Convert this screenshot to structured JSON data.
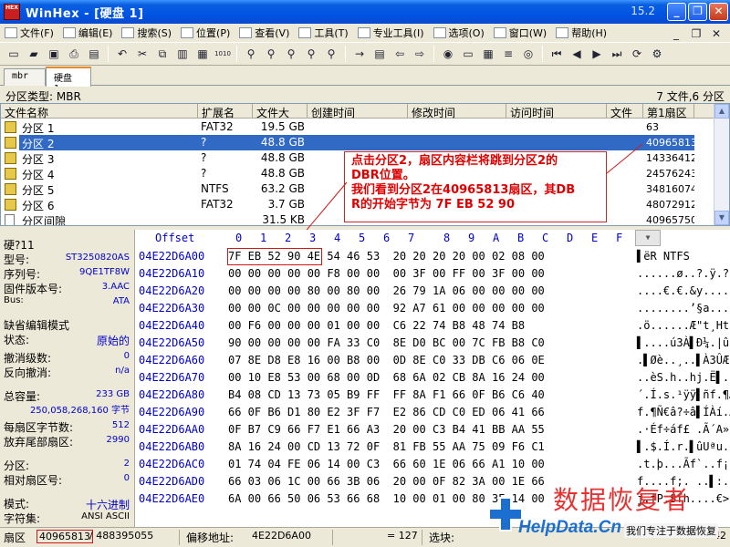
{
  "window": {
    "title": "WinHex - [硬盘 1]",
    "version": "15.2",
    "icon_label": "HEX"
  },
  "menu": [
    "文件(F)",
    "编辑(E)",
    "搜索(S)",
    "位置(P)",
    "查看(V)",
    "工具(T)",
    "专业工具(I)",
    "选项(O)",
    "窗口(W)",
    "帮助(H)"
  ],
  "tabs": [
    "mbr",
    "硬盘 1"
  ],
  "partition_info": {
    "label": "分区类型: MBR",
    "summary": "7 文件,6 分区"
  },
  "file_list": {
    "columns": [
      "文件名称",
      "扩展名",
      "文件大",
      "创建时间",
      "修改时间",
      "访问时间",
      "文件",
      "第1扇区"
    ],
    "rows": [
      {
        "name": "分区 1",
        "fs": "FAT32",
        "size": "19.5 GB",
        "sector": "63"
      },
      {
        "name": "分区 2",
        "fs": "?",
        "size": "48.8 GB",
        "sector": "40965813"
      },
      {
        "name": "分区 3",
        "fs": "?",
        "size": "48.8 GB",
        "sector": "143364123"
      },
      {
        "name": "分区 4",
        "fs": "?",
        "size": "48.8 GB",
        "sector": "245762433"
      },
      {
        "name": "分区 5",
        "fs": "NTFS",
        "size": "63.2 GB",
        "sector": "348160743"
      },
      {
        "name": "分区 6",
        "fs": "FAT32",
        "size": "3.7 GB",
        "sector": "480729123"
      },
      {
        "name": "分区间隙",
        "fs": "",
        "size": "31.5 KB",
        "sector": "40965750"
      }
    ]
  },
  "annotation": {
    "lines": [
      "点击分区2，扇区内容栏将跳到分区2的",
      "DBR位置。",
      "我们看到分区2在40965813扇区，其DB",
      "R的开始字节为 7F EB 52 90"
    ]
  },
  "info_panel": {
    "disk_label": "硬?11",
    "model_label": "型号:",
    "model": "ST3250820AS",
    "serial_label": "序列号:",
    "serial": "9QE1TF8W",
    "firmware_label": "固件版本号:",
    "firmware": "3.AAC",
    "bus_label": "Bus:",
    "bus": "ATA",
    "edit_mode_label": "缺省编辑模式",
    "state_label": "状态:",
    "state": "原始的",
    "undo_level_label": "撤消级数:",
    "undo_level": "0",
    "undo_reverse_label": "反向撤消:",
    "undo_reverse": "n/a",
    "capacity_label": "总容量:",
    "capacity": "233 GB",
    "capacity_bytes": "250,058,268,160 字节",
    "bytes_per_sector_label": "每扇区字节数:",
    "bytes_per_sector": "512",
    "surplus_sectors_label": "放弃尾部扇区:",
    "surplus_sectors": "2990",
    "partition_label": "分区:",
    "partition": "2",
    "relative_sector_label": "相对扇区号:",
    "relative_sector": "0",
    "mode_label": "模式:",
    "mode": "十六进制",
    "charset_label": "字符集:",
    "charset": "ANSI ASCII"
  },
  "hex_view": {
    "offset_header": "Offset",
    "columns": [
      "0",
      "1",
      "2",
      "3",
      "4",
      "5",
      "6",
      "7",
      "8",
      "9",
      "A",
      "B",
      "C",
      "D",
      "E",
      "F"
    ],
    "rows": [
      {
        "offset": "04E22D6A00",
        "bytes": "7F EB 52 90 4E 54 46 53  20 20 20 20 00 02 08 00",
        "ascii": "▌ëR NTFS"
      },
      {
        "offset": "04E22D6A10",
        "bytes": "00 00 00 00 00 F8 00 00  00 3F 00 FF 00 3F 00 00",
        "ascii": "......ø..?.ÿ.?.."
      },
      {
        "offset": "04E22D6A20",
        "bytes": "00 00 00 00 80 00 80 00  26 79 1A 06 00 00 00 00",
        "ascii": "....€.€.&y......"
      },
      {
        "offset": "04E22D6A30",
        "bytes": "00 00 0C 00 00 00 00 00  92 A7 61 00 00 00 00 00",
        "ascii": "........’§a....."
      },
      {
        "offset": "04E22D6A40",
        "bytes": "00 F6 00 00 00 01 00 00  C6 22 74 B8 48 74 B8",
        "ascii": ".ö......Æ\"t¸Ht¸"
      },
      {
        "offset": "04E22D6A50",
        "bytes": "90 00 00 00 00 FA 33 C0  8E D0 BC 00 7C FB B8 C0",
        "ascii": "▌....ú3À▌Ð¼.|û¸À"
      },
      {
        "offset": "04E22D6A60",
        "bytes": "07 8E D8 E8 16 00 B8 00  0D 8E C0 33 DB C6 06 0E",
        "ascii": ".▌Øè..¸..▌À3ÛÆ.."
      },
      {
        "offset": "04E22D6A70",
        "bytes": "00 10 E8 53 00 68 00 0D  68 6A 02 CB 8A 16 24 00",
        "ascii": "..èS.h..hj.Ë▌.$."
      },
      {
        "offset": "04E22D6A80",
        "bytes": "B4 08 CD 13 73 05 B9 FF  FF 8A F1 66 0F B6 C6 40",
        "ascii": "´.Í.s.¹ÿÿ▌ñf.¶Æ@"
      },
      {
        "offset": "04E22D6A90",
        "bytes": "66 0F B6 D1 80 E2 3F F7  E2 86 CD C0 ED 06 41 66",
        "ascii": "f.¶Ñ€â?÷â▌ÍÀí.Af"
      },
      {
        "offset": "04E22D6AA0",
        "bytes": "0F B7 C9 66 F7 E1 66 A3  20 00 C3 B4 41 BB AA 55",
        "ascii": ".·Éf÷áf£ .Ã´A»ªU"
      },
      {
        "offset": "04E22D6AB0",
        "bytes": "8A 16 24 00 CD 13 72 0F  81 FB 55 AA 75 09 F6 C1",
        "ascii": "▌.$.Í.r.▌ûUªu.öÁ"
      },
      {
        "offset": "04E22D6AC0",
        "bytes": "01 74 04 FE 06 14 00 C3  66 60 1E 06 66 A1 10 00",
        "ascii": ".t.þ...Ãf`..f¡.."
      },
      {
        "offset": "04E22D6AD0",
        "bytes": "66 03 06 1C 00 66 3B 06  20 00 0F 82 3A 00 1E 66",
        "ascii": "f....f;. ..▌:..f"
      },
      {
        "offset": "04E22D6AE0",
        "bytes": "6A 00 66 50 06 53 66 68  10 00 01 00 80 3E 14 00",
        "ascii": "j.fP.Sfh....€>.."
      }
    ]
  },
  "status_bar": {
    "sector_label": "扇区",
    "sector": "40965813",
    "sector_total": "/ 488395055",
    "offset_label": "偏移地址:",
    "offset": "4E22D6A00",
    "value": "= 127",
    "block_label": "选块:",
    "page": "42"
  },
  "watermark": {
    "title": "数据恢复者",
    "url": "HelpData.Cn",
    "tagline": "我们专注于数据恢复"
  }
}
